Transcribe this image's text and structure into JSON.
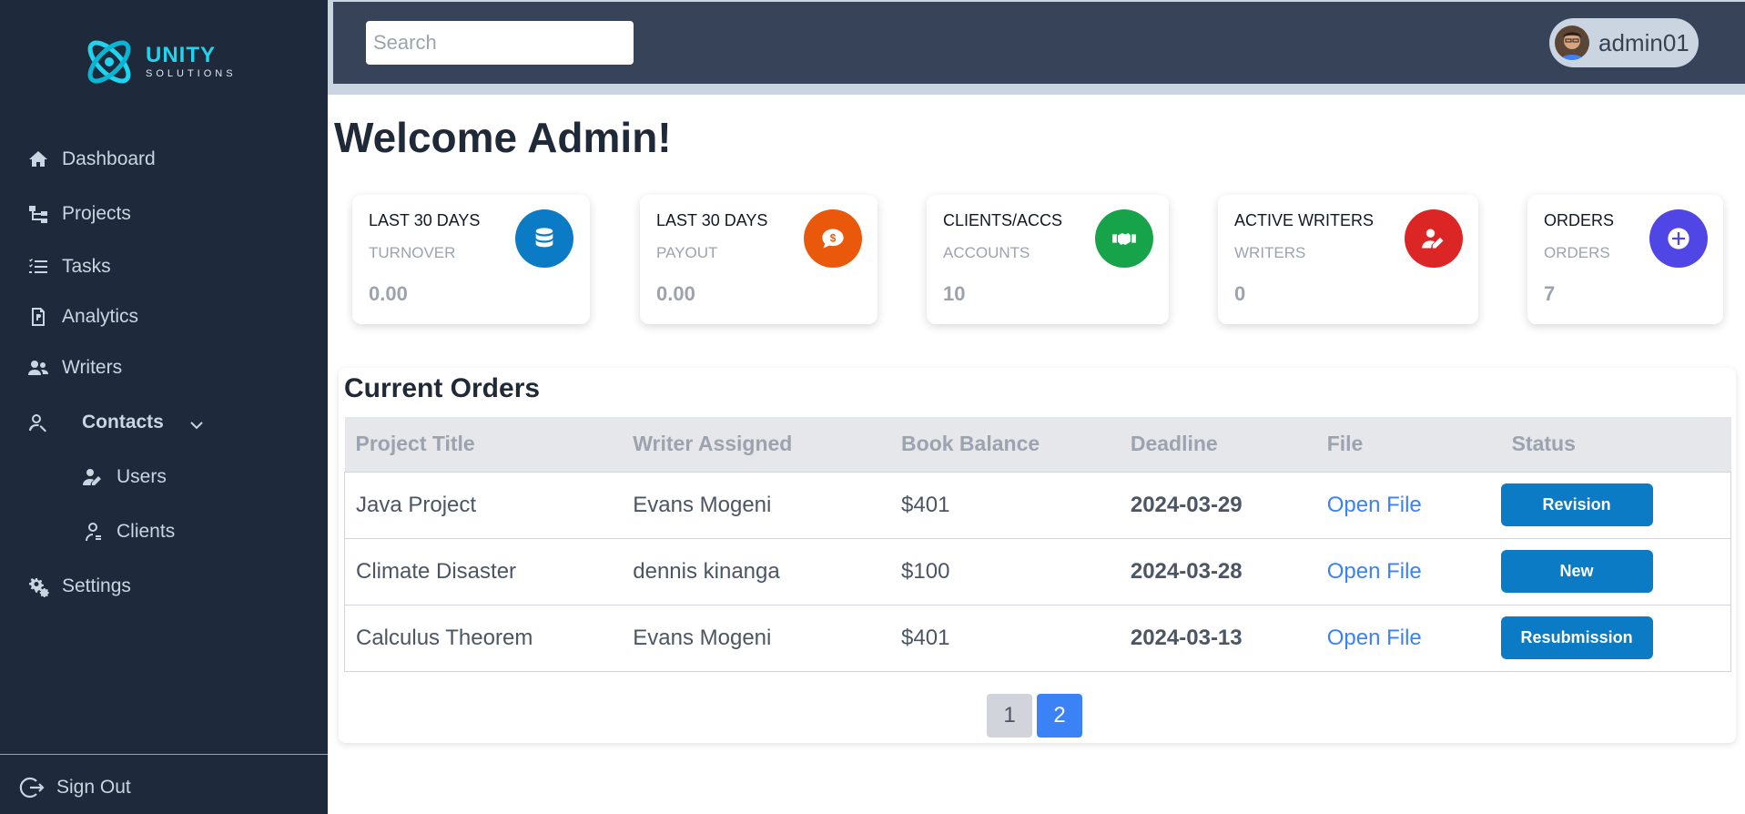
{
  "brand": {
    "name": "UNITY",
    "sub": "SOLUTIONS",
    "accent": "#22d3ee"
  },
  "sidebar": {
    "items": [
      {
        "label": "Dashboard",
        "icon": "home-icon"
      },
      {
        "label": "Projects",
        "icon": "sitemap-icon"
      },
      {
        "label": "Tasks",
        "icon": "list-check-icon"
      },
      {
        "label": "Analytics",
        "icon": "file-report-icon"
      },
      {
        "label": "Writers",
        "icon": "users-icon"
      },
      {
        "label": "Contacts",
        "icon": "contacts-icon",
        "expanded": true
      },
      {
        "label": "Users",
        "icon": "user-edit-icon"
      },
      {
        "label": "Clients",
        "icon": "user-outline-icon"
      },
      {
        "label": "Settings",
        "icon": "gears-icon"
      }
    ],
    "signout": "Sign Out"
  },
  "header": {
    "search_placeholder": "Search",
    "username": "admin01"
  },
  "welcome": "Welcome Admin!",
  "cards": [
    {
      "title": "LAST 30 DAYS",
      "sub": "TURNOVER",
      "value": "0.00",
      "color": "#0a7bc4",
      "icon": "database-icon"
    },
    {
      "title": "LAST 30 DAYS",
      "sub": "PAYOUT",
      "value": "0.00",
      "color": "#ea580c",
      "icon": "dollar-comment-icon"
    },
    {
      "title": "CLIENTS/ACCS",
      "sub": "ACCOUNTS",
      "value": "10",
      "color": "#16a34a",
      "icon": "handshake-icon"
    },
    {
      "title": "ACTIVE WRITERS",
      "sub": "WRITERS",
      "value": "0",
      "color": "#dc2626",
      "icon": "user-pen-icon"
    },
    {
      "title": "ORDERS",
      "sub": "ORDERS",
      "value": "7",
      "color": "#4f46e5",
      "icon": "plus-circle-icon"
    }
  ],
  "orders": {
    "title": "Current Orders",
    "columns": [
      "Project Title",
      "Writer Assigned",
      "Book Balance",
      "Deadline",
      "File",
      "Status"
    ],
    "rows": [
      {
        "project": "Java Project",
        "writer": "Evans Mogeni",
        "balance": "$401",
        "deadline": "2024-03-29",
        "file": "Open File",
        "status": "Revision"
      },
      {
        "project": "Climate Disaster",
        "writer": "dennis kinanga",
        "balance": "$100",
        "deadline": "2024-03-28",
        "file": "Open File",
        "status": "New"
      },
      {
        "project": "Calculus Theorem",
        "writer": "Evans Mogeni",
        "balance": "$401",
        "deadline": "2024-03-13",
        "file": "Open File",
        "status": "Resubmission"
      }
    ],
    "pages": [
      "1",
      "2"
    ],
    "current_page": "2"
  }
}
